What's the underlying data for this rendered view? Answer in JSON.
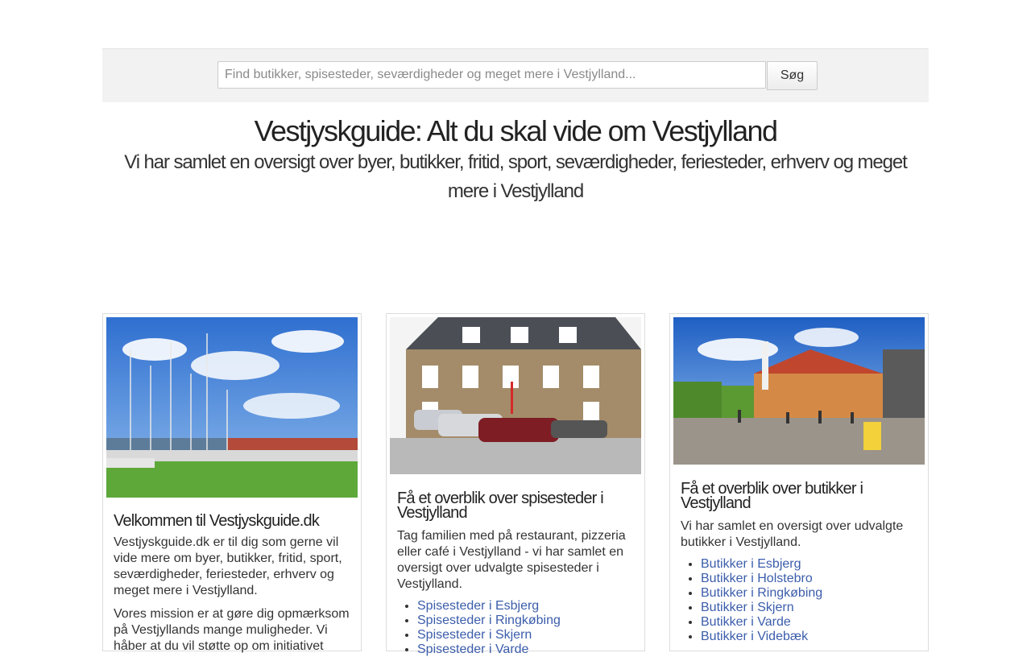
{
  "search": {
    "placeholder": "Find butikker, spisesteder, seværdigheder og meget mere i Vestjylland...",
    "button_label": "Søg"
  },
  "hero": {
    "title": "Vestjyskguide: Alt du skal vide om Vestjylland",
    "subtitle": "Vi har samlet en oversigt over byer, butikker, fritid, sport, seværdigheder, feriesteder, erhverv og meget mere i Vestjylland"
  },
  "cards": [
    {
      "photo_icon": "harbor-photo",
      "heading": "Velkommen til Vestjyskguide.dk",
      "paragraphs": [
        "Vestjyskguide.dk er til dig som gerne vil vide mere om byer, butikker, fritid, sport, seværdigheder, feriesteder, erhverv og meget mere i Vestjylland.",
        "Vores mission er at gøre dig opmærksom på Vestjyllands mange muligheder. Vi håber at du vil støtte op om initiativet"
      ]
    },
    {
      "photo_icon": "restaurant-building-photo",
      "heading": "Få et overblik over spisesteder i Vestjylland",
      "paragraphs": [
        "Tag familien med på restaurant, pizzeria eller café i Vestjylland - vi har samlet en oversigt over udvalgte spisesteder i Vestjylland."
      ],
      "links": [
        "Spisesteder i Esbjerg",
        "Spisesteder i Ringkøbing",
        "Spisesteder i Skjern",
        "Spisesteder i Varde"
      ]
    },
    {
      "photo_icon": "town-square-photo",
      "heading": "Få et overblik over butikker i Vestjylland",
      "paragraphs": [
        "Vi har samlet en oversigt over udvalgte butikker i Vestjylland."
      ],
      "links": [
        "Butikker i Esbjerg",
        "Butikker i Holstebro",
        "Butikker i Ringkøbing",
        "Butikker i Skjern",
        "Butikker i Varde",
        "Butikker i Videbæk"
      ]
    }
  ],
  "colors": {
    "link": "#3b5dab",
    "search_bar_bg": "#f2f2f2"
  }
}
